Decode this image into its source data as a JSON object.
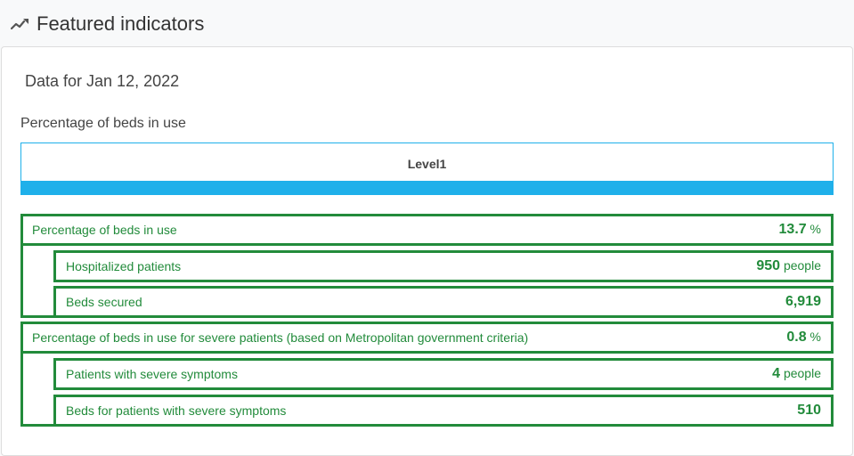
{
  "header": {
    "title": "Featured indicators",
    "icon": "trend-line-icon"
  },
  "date_label": "Data for Jan 12, 2022",
  "section_label": "Percentage of beds in use",
  "level": {
    "label": "Level1",
    "color": "#1fb0ea"
  },
  "accent_color": "#228b3b",
  "groups": [
    {
      "main": {
        "label": "Percentage of beds in use",
        "value": "13.7",
        "unit": "%"
      },
      "subs": [
        {
          "label": "Hospitalized patients",
          "value": "950",
          "unit": "people"
        },
        {
          "label": "Beds secured",
          "value": "6,919",
          "unit": ""
        }
      ]
    },
    {
      "main": {
        "label": "Percentage of beds in use for severe patients (based on Metropolitan government criteria)",
        "value": "0.8",
        "unit": "%"
      },
      "subs": [
        {
          "label": "Patients with severe symptoms",
          "value": "4",
          "unit": "people"
        },
        {
          "label": "Beds for patients with severe symptoms",
          "value": "510",
          "unit": ""
        }
      ]
    }
  ]
}
